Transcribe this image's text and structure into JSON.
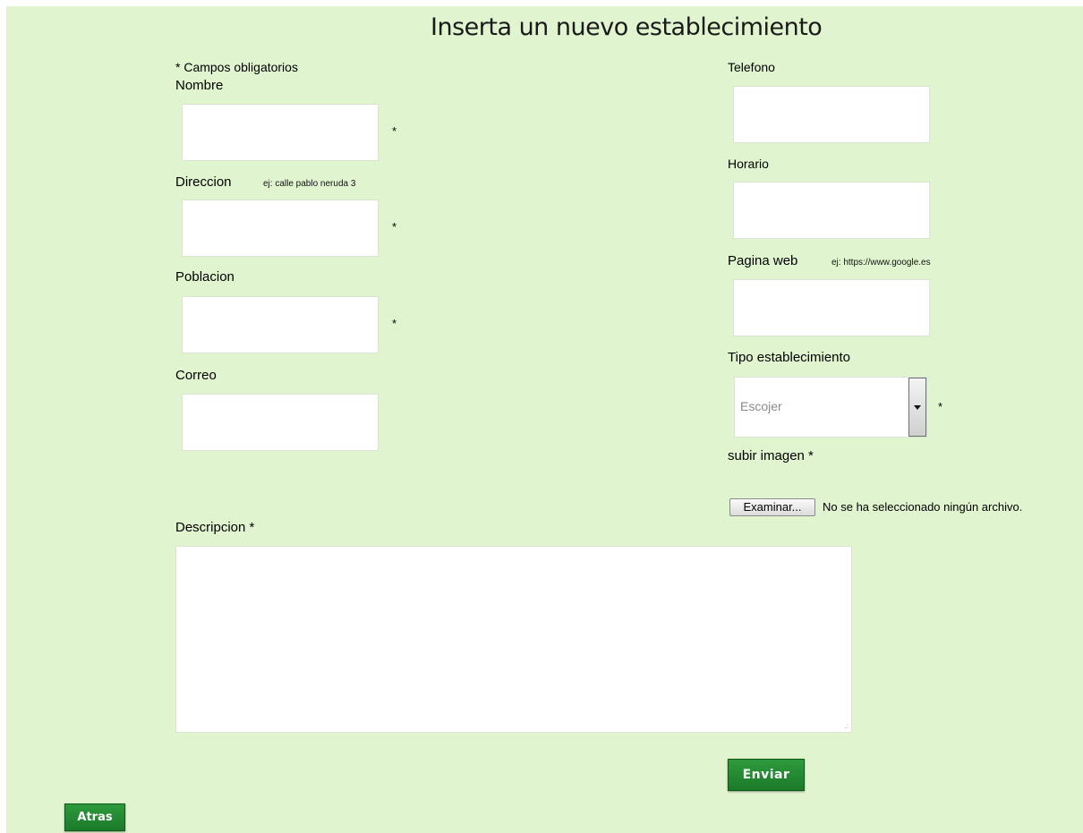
{
  "page": {
    "title": "Inserta un nuevo establecimiento",
    "required_note": "* Campos obligatorios"
  },
  "left": {
    "nombre": {
      "label": "Nombre",
      "required_mark": "*",
      "value": ""
    },
    "direccion": {
      "label": "Direccion",
      "hint": "ej: calle pablo neruda 3",
      "required_mark": "*",
      "value": ""
    },
    "poblacion": {
      "label": "Poblacion",
      "required_mark": "*",
      "value": ""
    },
    "correo": {
      "label": "Correo",
      "value": ""
    }
  },
  "right": {
    "telefono": {
      "label": "Telefono",
      "value": ""
    },
    "horario": {
      "label": "Horario",
      "value": ""
    },
    "pagina_web": {
      "label": "Pagina web",
      "hint": "ej: https://www.google.es",
      "value": ""
    },
    "tipo": {
      "label": "Tipo establecimiento",
      "selected": "Escojer",
      "required_mark": "*"
    },
    "imagen": {
      "label": "subir imagen *",
      "button_label": "Examinar...",
      "status": "No se ha seleccionado ningún archivo."
    }
  },
  "descripcion": {
    "label": "Descripcion *",
    "value": ""
  },
  "buttons": {
    "enviar": "Enviar",
    "atras": "Atras"
  }
}
